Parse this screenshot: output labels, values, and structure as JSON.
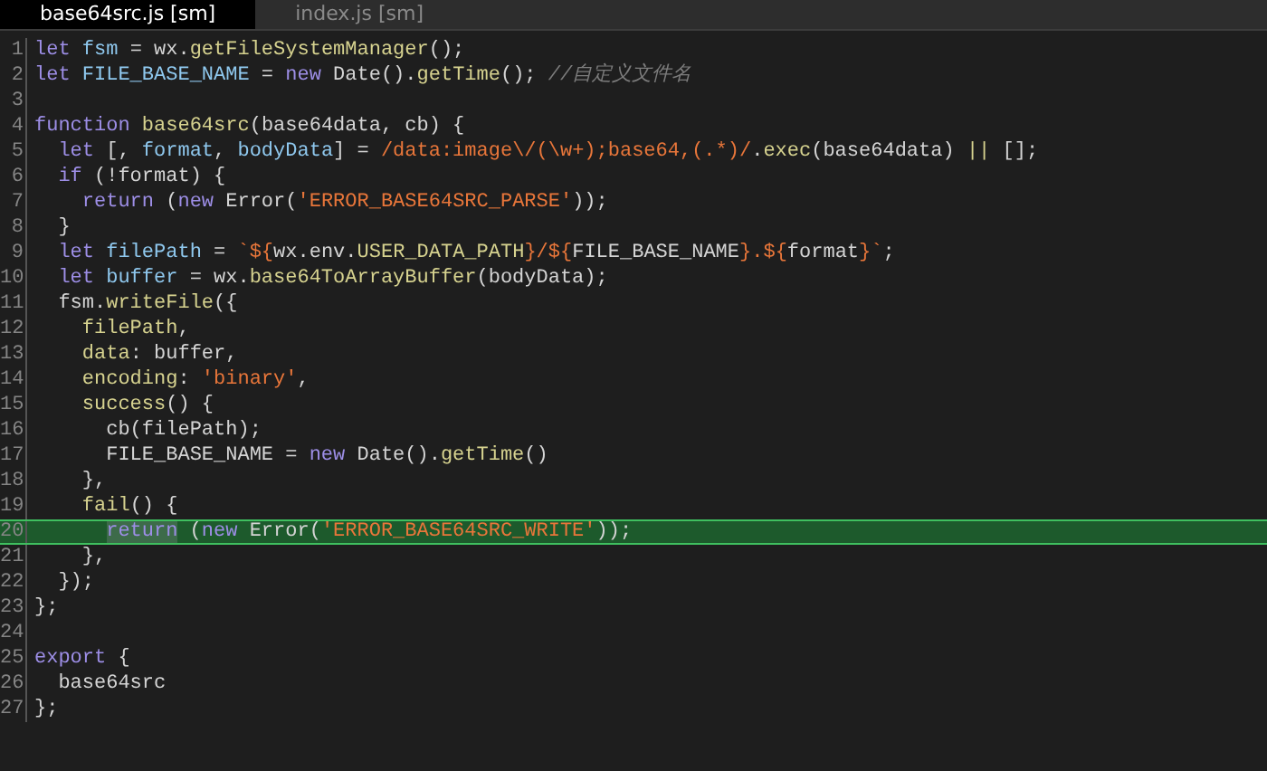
{
  "tabs": [
    {
      "label": "base64src.js [sm]",
      "selected": true
    },
    {
      "label": "index.js [sm]",
      "selected": false
    }
  ],
  "lines": [
    {
      "number": "1",
      "selected": false,
      "tokens": [
        {
          "kind": "kw",
          "text": "let "
        },
        {
          "kind": "var",
          "text": "fsm"
        },
        {
          "kind": "plain",
          "text": " = wx."
        },
        {
          "kind": "fn",
          "text": "getFileSystemManager"
        },
        {
          "kind": "plain",
          "text": "();"
        }
      ]
    },
    {
      "number": "2",
      "selected": false,
      "tokens": [
        {
          "kind": "kw",
          "text": "let "
        },
        {
          "kind": "var",
          "text": "FILE_BASE_NAME"
        },
        {
          "kind": "plain",
          "text": " = "
        },
        {
          "kind": "kw",
          "text": "new"
        },
        {
          "kind": "plain",
          "text": " Date()."
        },
        {
          "kind": "fn",
          "text": "getTime"
        },
        {
          "kind": "plain",
          "text": "(); "
        },
        {
          "kind": "comment",
          "text": "//自定义文件名"
        }
      ]
    },
    {
      "number": "3",
      "selected": false
    },
    {
      "number": "4",
      "selected": false,
      "tokens": [
        {
          "kind": "kw",
          "text": "function "
        },
        {
          "kind": "fn",
          "text": "base64src"
        },
        {
          "kind": "plain",
          "text": "(base64data, cb) {"
        }
      ]
    },
    {
      "number": "5",
      "selected": false,
      "tokens": [
        {
          "kind": "kw",
          "text": "  let"
        },
        {
          "kind": "plain",
          "text": " [, "
        },
        {
          "kind": "var",
          "text": "format"
        },
        {
          "kind": "plain",
          "text": ", "
        },
        {
          "kind": "var",
          "text": "bodyData"
        },
        {
          "kind": "plain",
          "text": "] = "
        },
        {
          "kind": "str",
          "text": "/data:image\\/(\\w+);base64,(.*)/"
        },
        {
          "kind": "plain",
          "text": "."
        },
        {
          "kind": "fn",
          "text": "exec"
        },
        {
          "kind": "plain",
          "text": "(base64data) "
        },
        {
          "kind": "fn",
          "text": "||"
        },
        {
          "kind": "plain",
          "text": " [];"
        }
      ]
    },
    {
      "number": "6",
      "selected": false,
      "tokens": [
        {
          "kind": "kw",
          "text": "  if"
        },
        {
          "kind": "plain",
          "text": " (!format) {"
        }
      ]
    },
    {
      "number": "7",
      "selected": false,
      "tokens": [
        {
          "kind": "kw",
          "text": "    return"
        },
        {
          "kind": "plain",
          "text": " ("
        },
        {
          "kind": "kw",
          "text": "new"
        },
        {
          "kind": "plain",
          "text": " Error("
        },
        {
          "kind": "str",
          "text": "'ERROR_BASE64SRC_PARSE'"
        },
        {
          "kind": "plain",
          "text": "));"
        }
      ]
    },
    {
      "number": "8",
      "selected": false,
      "tokens": [
        {
          "kind": "plain",
          "text": "  }"
        }
      ]
    },
    {
      "number": "9",
      "selected": false,
      "tokens": [
        {
          "kind": "kw",
          "text": "  let "
        },
        {
          "kind": "var",
          "text": "filePath"
        },
        {
          "kind": "plain",
          "text": " = "
        },
        {
          "kind": "str",
          "text": "`${"
        },
        {
          "kind": "plain",
          "text": "wx.env."
        },
        {
          "kind": "fn",
          "text": "USER_DATA_PATH"
        },
        {
          "kind": "str",
          "text": "}/${"
        },
        {
          "kind": "plain",
          "text": "FILE_BASE_NAME"
        },
        {
          "kind": "str",
          "text": "}.${"
        },
        {
          "kind": "plain",
          "text": "format"
        },
        {
          "kind": "str",
          "text": "}`"
        },
        {
          "kind": "plain",
          "text": ";"
        }
      ]
    },
    {
      "number": "10",
      "selected": false,
      "tokens": [
        {
          "kind": "kw",
          "text": "  let "
        },
        {
          "kind": "var",
          "text": "buffer"
        },
        {
          "kind": "plain",
          "text": " = wx."
        },
        {
          "kind": "fn",
          "text": "base64ToArrayBuffer"
        },
        {
          "kind": "plain",
          "text": "(bodyData);"
        }
      ]
    },
    {
      "number": "11",
      "selected": false,
      "tokens": [
        {
          "kind": "plain",
          "text": "  fsm."
        },
        {
          "kind": "fn",
          "text": "writeFile"
        },
        {
          "kind": "plain",
          "text": "({"
        }
      ]
    },
    {
      "number": "12",
      "selected": false,
      "tokens": [
        {
          "kind": "fn",
          "text": "    filePath"
        },
        {
          "kind": "plain",
          "text": ","
        }
      ]
    },
    {
      "number": "13",
      "selected": false,
      "tokens": [
        {
          "kind": "fn",
          "text": "    data"
        },
        {
          "kind": "plain",
          "text": ": buffer,"
        }
      ]
    },
    {
      "number": "14",
      "selected": false,
      "tokens": [
        {
          "kind": "fn",
          "text": "    encoding"
        },
        {
          "kind": "plain",
          "text": ": "
        },
        {
          "kind": "str",
          "text": "'binary'"
        },
        {
          "kind": "plain",
          "text": ","
        }
      ]
    },
    {
      "number": "15",
      "selected": false,
      "tokens": [
        {
          "kind": "fn",
          "text": "    success"
        },
        {
          "kind": "plain",
          "text": "() {"
        }
      ]
    },
    {
      "number": "16",
      "selected": false,
      "tokens": [
        {
          "kind": "plain",
          "text": "      cb(filePath);"
        }
      ]
    },
    {
      "number": "17",
      "selected": false,
      "tokens": [
        {
          "kind": "plain",
          "text": "      FILE_BASE_NAME = "
        },
        {
          "kind": "kw",
          "text": "new"
        },
        {
          "kind": "plain",
          "text": " Date()."
        },
        {
          "kind": "fn",
          "text": "getTime"
        },
        {
          "kind": "plain",
          "text": "()"
        }
      ]
    },
    {
      "number": "18",
      "selected": false,
      "tokens": [
        {
          "kind": "plain",
          "text": "    },"
        }
      ]
    },
    {
      "number": "19",
      "selected": false,
      "tokens": [
        {
          "kind": "fn",
          "text": "    fail"
        },
        {
          "kind": "plain",
          "text": "() {"
        }
      ]
    },
    {
      "number": "20",
      "selected": true,
      "tokens": [
        {
          "kind": "match",
          "text": "return"
        },
        {
          "kind": "plain",
          "text": " ("
        },
        {
          "kind": "kw",
          "text": "new"
        },
        {
          "kind": "plain",
          "text": " Error("
        },
        {
          "kind": "str",
          "text": "'ERROR_BASE64SRC_WRITE'"
        },
        {
          "kind": "plain",
          "text": "));"
        }
      ]
    },
    {
      "number": "21",
      "selected": false,
      "tokens": [
        {
          "kind": "plain",
          "text": "    },"
        }
      ]
    },
    {
      "number": "22",
      "selected": false,
      "tokens": [
        {
          "kind": "plain",
          "text": "  });"
        }
      ]
    },
    {
      "number": "23",
      "selected": false,
      "tokens": [
        {
          "kind": "plain",
          "text": "};"
        }
      ]
    },
    {
      "number": "24",
      "selected": false
    },
    {
      "number": "25",
      "selected": false,
      "tokens": [
        {
          "kind": "kw",
          "text": "export"
        },
        {
          "kind": "plain",
          "text": " {"
        }
      ]
    },
    {
      "number": "26",
      "selected": false,
      "tokens": [
        {
          "kind": "plain",
          "text": "  base64src"
        }
      ]
    },
    {
      "number": "27",
      "selected": false,
      "tokens": [
        {
          "kind": "plain",
          "text": "};"
        }
      ]
    }
  ]
}
